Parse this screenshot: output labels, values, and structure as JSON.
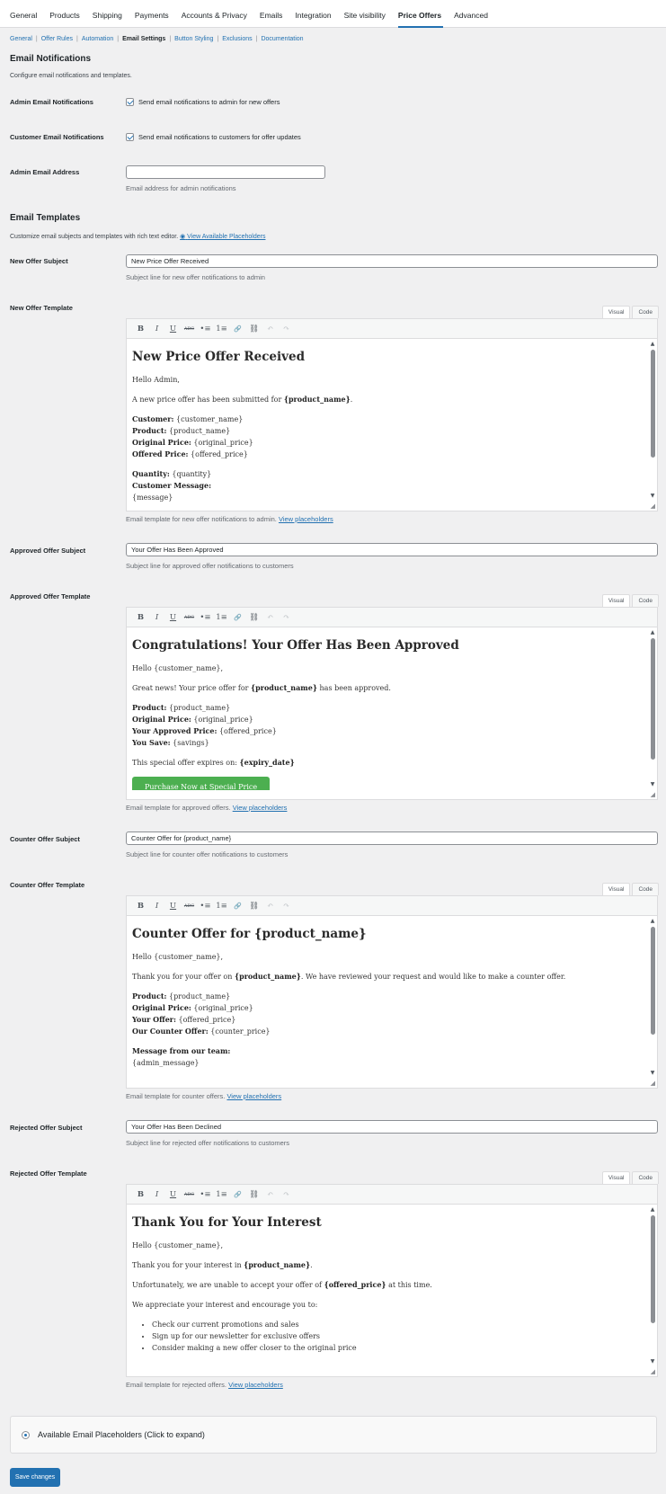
{
  "nav_tabs": [
    "General",
    "Products",
    "Shipping",
    "Payments",
    "Accounts & Privacy",
    "Emails",
    "Integration",
    "Site visibility",
    "Price Offers",
    "Advanced"
  ],
  "active_tab": "Price Offers",
  "subsub": {
    "items": [
      "General",
      "Offer Rules",
      "Automation",
      "Email Settings",
      "Button Styling",
      "Exclusions",
      "Documentation"
    ],
    "current": "Email Settings",
    "separator": "|"
  },
  "notifications": {
    "heading": "Email Notifications",
    "description": "Configure email notifications and templates.",
    "admin_label": "Admin Email Notifications",
    "admin_checkbox": "Send email notifications to admin for new offers",
    "customer_label": "Customer Email Notifications",
    "customer_checkbox": "Send email notifications to customers for offer updates",
    "address_label": "Admin Email Address",
    "address_value": "",
    "address_hint": "Email address for admin notifications"
  },
  "templates": {
    "heading": "Email Templates",
    "description": "Customize email subjects and templates with rich text editor.",
    "view_link": "View Available Placeholders",
    "view_link_icon": "◉",
    "mode_visual": "Visual",
    "mode_code": "Code",
    "view_placeholders": "View placeholders",
    "new_subject_label": "New Offer Subject",
    "new_subject_value": "New Price Offer Received",
    "new_subject_hint": "Subject line for new offer notifications to admin",
    "new_template_label": "New Offer Template",
    "new_template_hint": "Email template for new offer notifications to admin.",
    "approved_subject_label": "Approved Offer Subject",
    "approved_subject_value": "Your Offer Has Been Approved",
    "approved_subject_hint": "Subject line for approved offer notifications to customers",
    "approved_template_label": "Approved Offer Template",
    "approved_template_hint": "Email template for approved offers.",
    "counter_subject_label": "Counter Offer Subject",
    "counter_subject_value": "Counter Offer for {product_name}",
    "counter_subject_hint": "Subject line for counter offer notifications to customers",
    "counter_template_label": "Counter Offer Template",
    "counter_template_hint": "Email template for counter offers.",
    "rejected_subject_label": "Rejected Offer Subject",
    "rejected_subject_value": "Your Offer Has Been Declined",
    "rejected_subject_hint": "Subject line for rejected offer notifications to customers",
    "rejected_template_label": "Rejected Offer Template",
    "rejected_template_hint": "Email template for rejected offers."
  },
  "toolbar_icons": [
    {
      "name": "bold-icon",
      "glyph": "B"
    },
    {
      "name": "italic-icon",
      "glyph": "I"
    },
    {
      "name": "underline-icon",
      "glyph": "U"
    },
    {
      "name": "strikethrough-icon",
      "glyph": "ABC"
    },
    {
      "name": "bullet-list-icon",
      "glyph": "•≡"
    },
    {
      "name": "numbered-list-icon",
      "glyph": "1≡"
    },
    {
      "name": "link-icon",
      "glyph": "🔗"
    },
    {
      "name": "unlink-icon",
      "glyph": "⛓"
    },
    {
      "name": "undo-icon",
      "glyph": "↶"
    },
    {
      "name": "redo-icon",
      "glyph": "↷"
    }
  ],
  "new_email": {
    "heading": "New Price Offer Received",
    "greeting": "Hello Admin,",
    "intro_pre": "A new price offer has been submitted for ",
    "intro_bold": "{product_name}",
    "intro_post": ".",
    "customer_k": "Customer:",
    "customer_v": " {customer_name}",
    "product_k": "Product:",
    "product_v": " {product_name}",
    "original_k": "Original Price:",
    "original_v": " {original_price}",
    "offered_k": "Offered Price:",
    "offered_v": " {offered_price}",
    "quantity_k": "Quantity:",
    "quantity_v": " {quantity}",
    "message_k": "Customer Message:",
    "message_v": "{message}"
  },
  "approved_email": {
    "heading": "Congratulations! Your Offer Has Been Approved",
    "greeting": "Hello {customer_name},",
    "intro_pre": "Great news! Your price offer for ",
    "intro_bold": "{product_name}",
    "intro_post": " has been approved.",
    "product_k": "Product:",
    "product_v": " {product_name}",
    "original_k": "Original Price:",
    "original_v": " {original_price}",
    "approved_k": "Your Approved Price:",
    "approved_v": " {offered_price}",
    "save_k": "You Save:",
    "save_v": " {savings}",
    "expiry_pre": "This special offer expires on: ",
    "expiry_bold": "{expiry_date}",
    "button": "Purchase Now at Special Price"
  },
  "counter_email": {
    "heading": "Counter Offer for {product_name}",
    "greeting": "Hello {customer_name},",
    "intro_pre": "Thank you for your offer on ",
    "intro_bold": "{product_name}",
    "intro_post": ". We have reviewed your request and would like to make a counter offer.",
    "product_k": "Product:",
    "product_v": " {product_name}",
    "original_k": "Original Price:",
    "original_v": " {original_price}",
    "your_k": "Your Offer:",
    "your_v": " {offered_price}",
    "counter_k": "Our Counter Offer:",
    "counter_v": " {counter_price}",
    "team_k": "Message from our team:",
    "team_v": "{admin_message}"
  },
  "rejected_email": {
    "heading": "Thank You for Your Interest",
    "greeting": "Hello {customer_name},",
    "intro_pre": "Thank you for your interest in ",
    "intro_bold": "{product_name}",
    "intro_post": ".",
    "unfortunately_pre": "Unfortunately, we are unable to accept your offer of ",
    "unfortunately_bold": "{offered_price}",
    "unfortunately_post": " at this time.",
    "encourage": "We appreciate your interest and encourage you to:",
    "list": [
      "Check our current promotions and sales",
      "Sign up for our newsletter for exclusive offers",
      "Consider making a new offer closer to the original price"
    ]
  },
  "placeholders_box": "Available Email Placeholders (Click to expand)",
  "save_button": "Save changes",
  "colors": {
    "accent": "#2271b1",
    "cta_green": "#4caf50",
    "background": "#f0f0f1"
  }
}
